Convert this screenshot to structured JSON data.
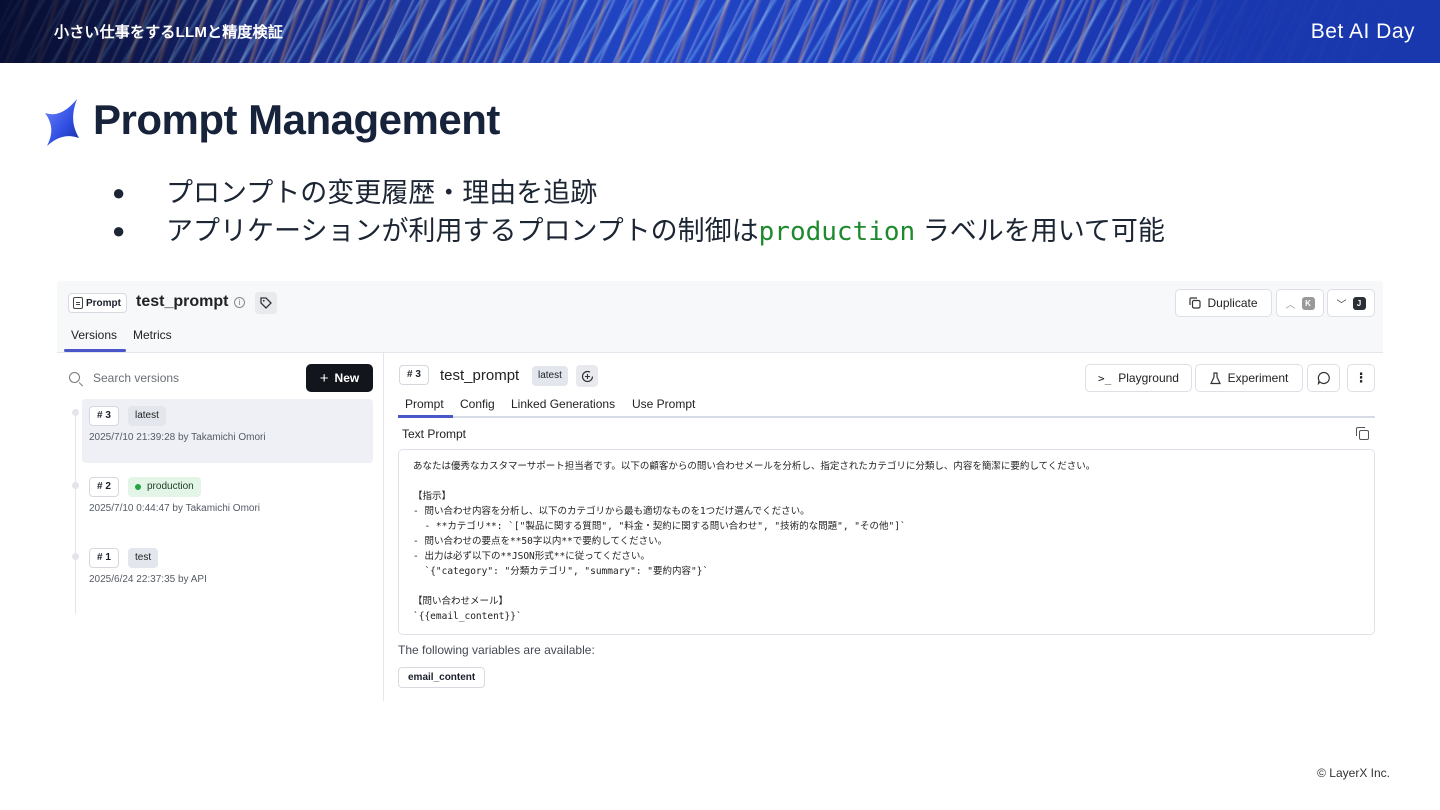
{
  "header": {
    "title": "小さい仕事をするLLMと精度検証",
    "brand": "Bet AI Day"
  },
  "slide": {
    "title": "Prompt Management",
    "bullets": [
      {
        "text": "プロンプトの変更履歴・理由を追跡"
      },
      {
        "text_before": "アプリケーションが利用するプロンプトの制御は",
        "code": "production",
        "text_after": " ラベルを用いて可能"
      }
    ]
  },
  "screenshot": {
    "top": {
      "chip_label": "Prompt",
      "name": "test_prompt",
      "duplicate_label": "Duplicate",
      "key_up": "K",
      "key_down": "J",
      "tabs": [
        "Versions",
        "Metrics"
      ]
    },
    "left": {
      "search_placeholder": "Search versions",
      "new_label": "New",
      "versions": [
        {
          "num": "# 3",
          "label": "latest",
          "meta": "2025/7/10 21:39:28 by Takamichi Omori"
        },
        {
          "num": "# 2",
          "label": "production",
          "meta": "2025/7/10 0:44:47 by Takamichi Omori"
        },
        {
          "num": "# 1",
          "label": "test",
          "meta": "2025/6/24 22:37:35 by API"
        }
      ]
    },
    "right": {
      "num": "# 3",
      "name": "test_prompt",
      "label": "latest",
      "playground_label": "Playground",
      "experiment_label": "Experiment",
      "tabs": [
        "Prompt",
        "Config",
        "Linked Generations",
        "Use Prompt"
      ],
      "text_prompt_label": "Text Prompt",
      "prompt_lines": [
        "あなたは優秀なカスタマーサポート担当者です。以下の顧客からの問い合わせメールを分析し、指定されたカテゴリに分類し、内容を簡潔に要約してください。",
        "",
        "【指示】",
        "- 問い合わせ内容を分析し、以下のカテゴリから最も適切なものを1つだけ選んでください。",
        "  - **カテゴリ**: `[\"製品に関する質問\", \"料金・契約に関する問い合わせ\", \"技術的な問題\", \"その他\"]`",
        "- 問い合わせの要点を**50字以内**で要約してください。",
        "- 出力は必ず以下の**JSON形式**に従ってください。",
        "  `{\"category\": \"分類カテゴリ\", \"summary\": \"要約内容\"}`",
        "",
        "【問い合わせメール】",
        "`{{email_content}}`"
      ],
      "vars_label": "The following variables are available:",
      "var_chip": "email_content"
    }
  },
  "footer": "© LayerX Inc."
}
